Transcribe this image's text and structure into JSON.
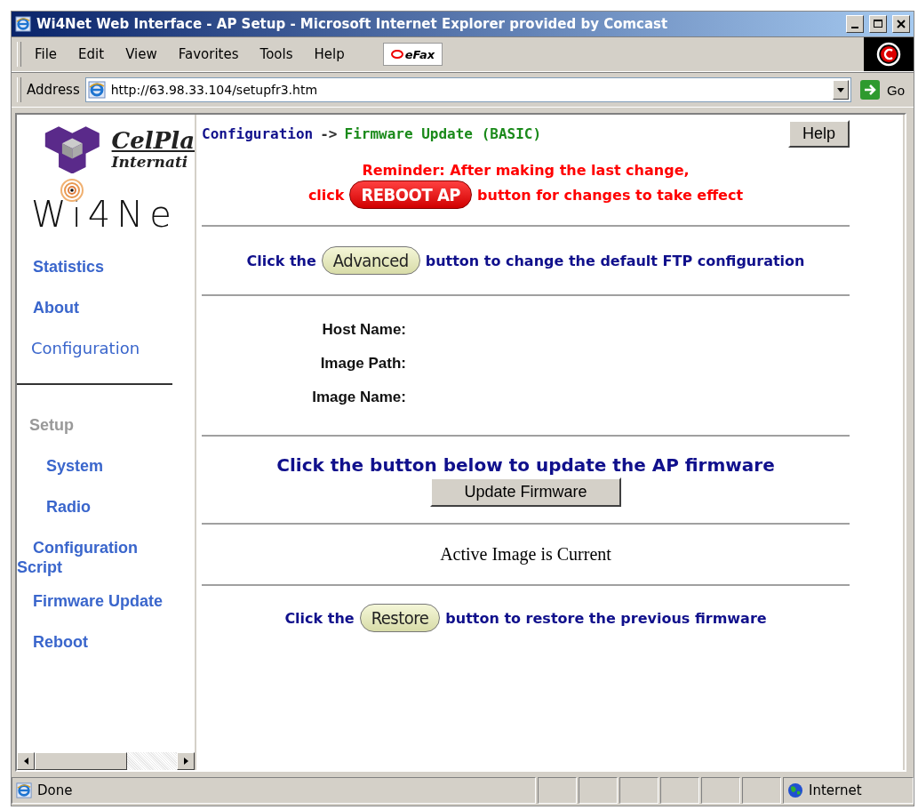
{
  "window": {
    "title": "Wi4Net Web Interface - AP Setup - Microsoft Internet Explorer provided by Comcast"
  },
  "menu": [
    "File",
    "Edit",
    "View",
    "Favorites",
    "Tools",
    "Help"
  ],
  "toolbar_button": "eFax",
  "address": {
    "label": "Address",
    "value": "http://63.98.33.104/setupfr3.htm",
    "go": "Go"
  },
  "logo": {
    "company": "CelPla",
    "company_sub": "Internati",
    "product": "Wi4Ne"
  },
  "sidebar": {
    "items": [
      {
        "label": "Statistics",
        "kind": "link"
      },
      {
        "label": "About",
        "kind": "link"
      },
      {
        "label": "Configuration",
        "kind": "plain"
      },
      {
        "kind": "divider"
      },
      {
        "label": "Setup",
        "kind": "heading"
      },
      {
        "label": "System",
        "kind": "sub"
      },
      {
        "label": "Radio",
        "kind": "sub"
      },
      {
        "label": "Configuration Script",
        "kind": "wrap"
      },
      {
        "label": "Firmware Update",
        "kind": "link"
      },
      {
        "label": "Reboot",
        "kind": "link"
      }
    ]
  },
  "breadcrumb": {
    "parent": "Configuration",
    "separator": "->",
    "current": "Firmware Update (BASIC)"
  },
  "help_button": "Help",
  "reminder": {
    "line1": "Reminder: After making the last change,",
    "before": "click",
    "button": "REBOOT AP",
    "after": "button for changes to take effect"
  },
  "advanced": {
    "before": "Click the",
    "button": "Advanced",
    "after": "button to change the default FTP configuration"
  },
  "fields": [
    {
      "label": "Host Name:"
    },
    {
      "label": "Image Path:"
    },
    {
      "label": "Image Name:"
    }
  ],
  "update": {
    "text": "Click the button below to update the AP firmware",
    "button": "Update Firmware"
  },
  "status_message": "Active Image is Current",
  "restore": {
    "before": "Click the",
    "button": "Restore",
    "after": "button to restore the previous firmware"
  },
  "status_bar": {
    "text": "Done",
    "zone": "Internet"
  }
}
